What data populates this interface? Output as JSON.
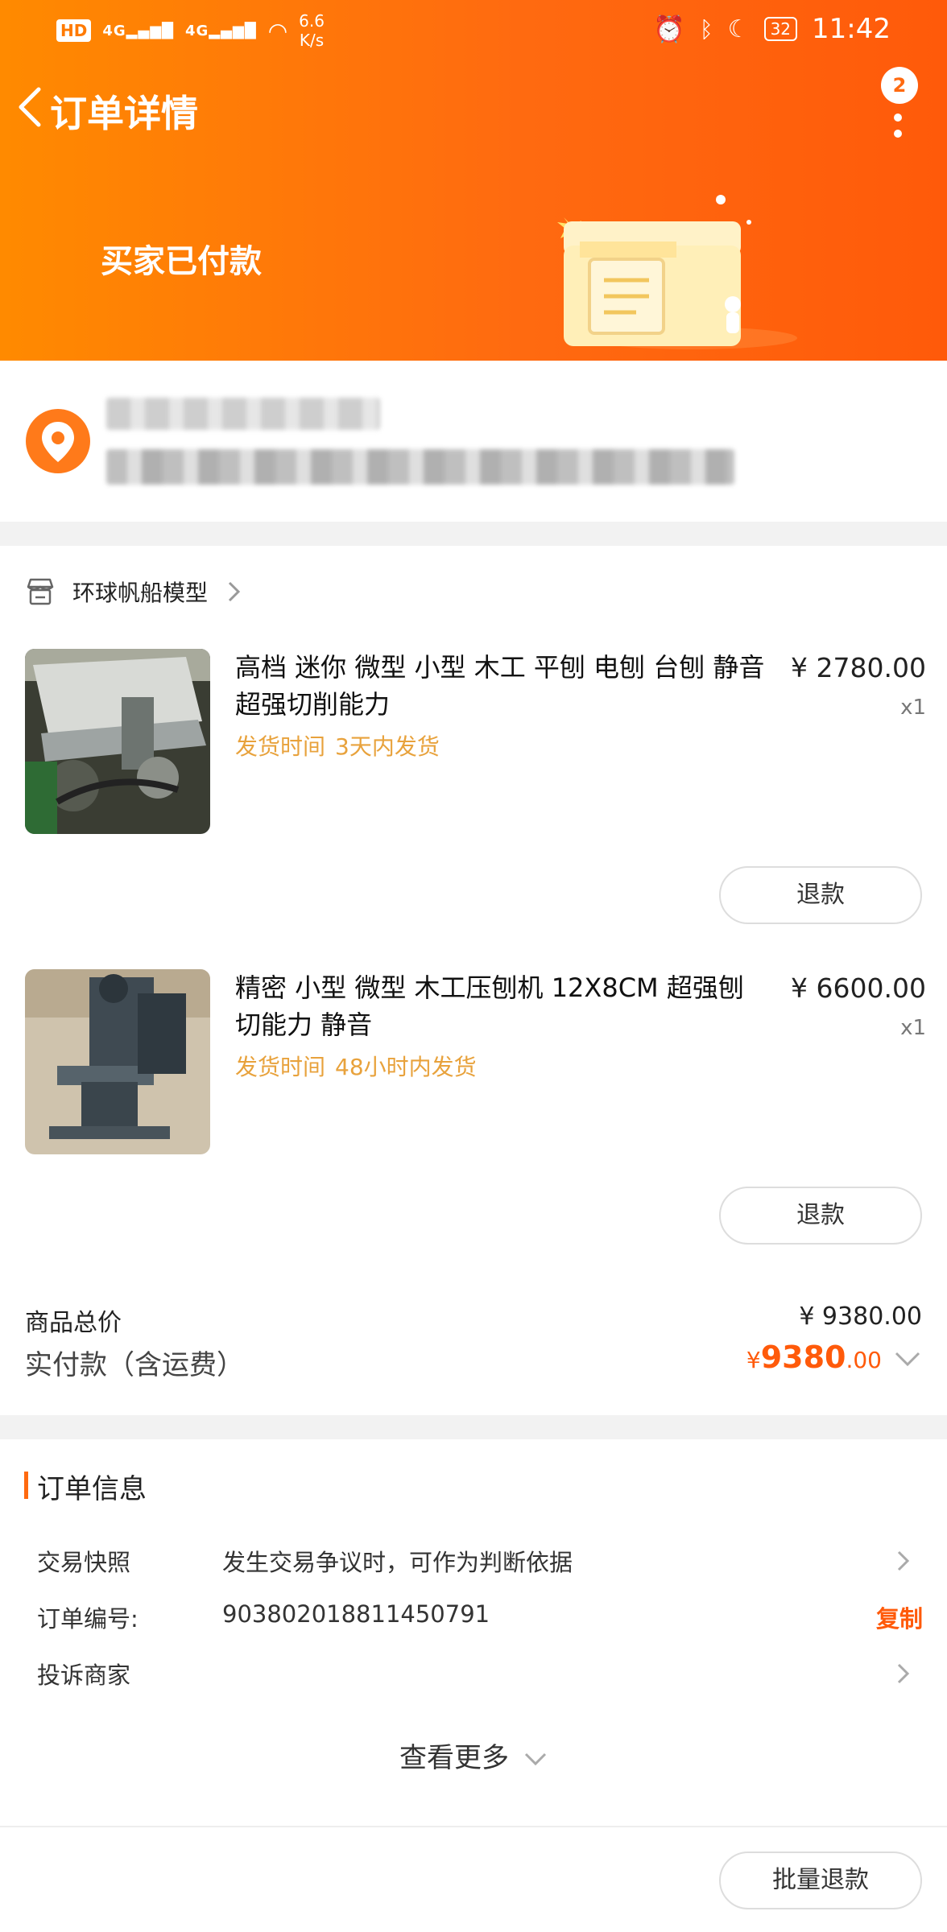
{
  "status_bar": {
    "hd_label": "HD",
    "signal1": "4G",
    "signal2": "4G",
    "speed_value": "6.6",
    "speed_unit": "K/s",
    "battery": "32",
    "time": "11:42"
  },
  "header": {
    "title": "订单详情",
    "badge_count": "2",
    "status": "买家已付款"
  },
  "shop": {
    "name": "环球帆船模型"
  },
  "products": [
    {
      "title": "高档 迷你 微型 小型 木工 平刨 电刨 台刨 静音 超强切削能力",
      "ship_label": "发货时间",
      "ship_value": "3天内发货",
      "price": "¥ 2780.00",
      "qty": "x1",
      "refund_label": "退款"
    },
    {
      "title": "精密 小型 微型 木工压刨机  12X8CM 超强刨切能力 静音",
      "ship_label": "发货时间",
      "ship_value": "48小时内发货",
      "price": "¥ 6600.00",
      "qty": "x1",
      "refund_label": "退款"
    }
  ],
  "summary": {
    "goods_total_label": "商品总价",
    "goods_total_value": "¥ 9380.00",
    "paid_label": "实付款（含运费）",
    "paid_currency": "¥",
    "paid_integer": "9380",
    "paid_decimal": ".00"
  },
  "order_info": {
    "title": "订单信息",
    "snapshot_label": "交易快照",
    "snapshot_value": "发生交易争议时，可作为判断依据",
    "order_no_label": "订单编号:",
    "order_no_value": "903802018811450791",
    "copy_label": "复制",
    "complain_label": "投诉商家",
    "see_more": "查看更多"
  },
  "bottom": {
    "batch_refund_label": "批量退款"
  },
  "colors": {
    "accent": "#ff6a10",
    "ship_text": "#e8a23c",
    "price_highlight": "#ff5a0a"
  }
}
